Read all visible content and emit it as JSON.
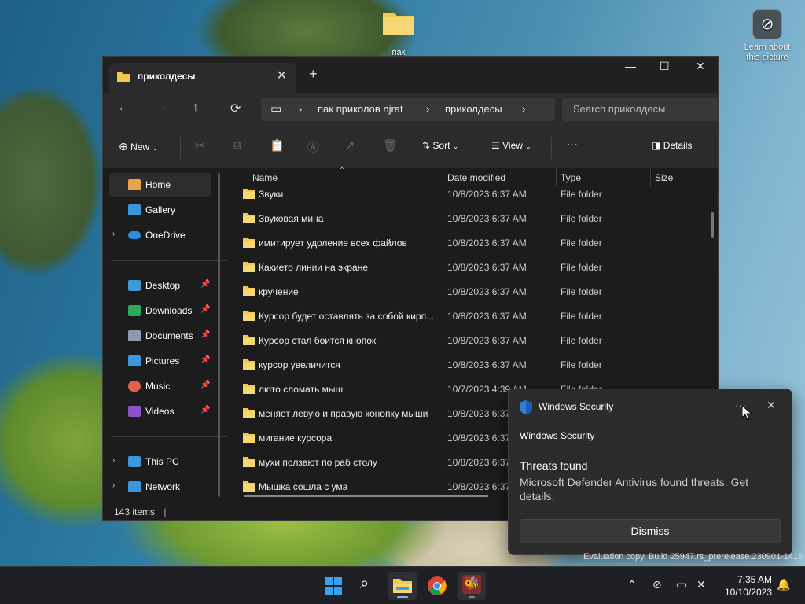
{
  "desktop": {
    "folder_label": "пак",
    "learn_label": "Learn about this picture"
  },
  "window": {
    "tab_title": "приколдесы",
    "new_tab": "+",
    "minimize": "—",
    "maximize": "☐",
    "close": "✕",
    "breadcrumb": [
      "пак приколов njrat",
      "приколдесы"
    ],
    "search_placeholder": "Search приколдесы"
  },
  "toolbar": {
    "new_label": "New",
    "sort_label": "Sort",
    "view_label": "View",
    "more": "···",
    "details_label": "Details"
  },
  "sidebar": {
    "items": [
      {
        "label": "Home",
        "icon": "home-icon",
        "color": "#e8a24b"
      },
      {
        "label": "Gallery",
        "icon": "gallery-icon",
        "color": "#3a96dd"
      },
      {
        "label": "OneDrive",
        "icon": "cloud-icon",
        "color": "#2b8de0"
      },
      {
        "label": "Desktop",
        "icon": "desktop-icon",
        "color": "#3a9bd5"
      },
      {
        "label": "Downloads",
        "icon": "download-icon",
        "color": "#2eaa5a"
      },
      {
        "label": "Documents",
        "icon": "document-icon",
        "color": "#8a9bb0"
      },
      {
        "label": "Pictures",
        "icon": "pictures-icon",
        "color": "#3a96dd"
      },
      {
        "label": "Music",
        "icon": "music-icon",
        "color": "#e0604b"
      },
      {
        "label": "Videos",
        "icon": "videos-icon",
        "color": "#8a54c8"
      },
      {
        "label": "This PC",
        "icon": "pc-icon",
        "color": "#3a96dd"
      },
      {
        "label": "Network",
        "icon": "network-icon",
        "color": "#3a96dd"
      }
    ]
  },
  "columns": {
    "name": "Name",
    "date": "Date modified",
    "type": "Type",
    "size": "Size"
  },
  "files": [
    {
      "name": "Звуки",
      "date": "10/8/2023 6:37 AM",
      "type": "File folder"
    },
    {
      "name": "Звуковая мина",
      "date": "10/8/2023 6:37 AM",
      "type": "File folder"
    },
    {
      "name": "имитирует удоление всех файлов",
      "date": "10/8/2023 6:37 AM",
      "type": "File folder"
    },
    {
      "name": "Какието линии на экране",
      "date": "10/8/2023 6:37 AM",
      "type": "File folder"
    },
    {
      "name": "кручение",
      "date": "10/8/2023 6:37 AM",
      "type": "File folder"
    },
    {
      "name": "Курсор будет оставлять за собой кирп...",
      "date": "10/8/2023 6:37 AM",
      "type": "File folder"
    },
    {
      "name": "Курсор стал боится кнопок",
      "date": "10/8/2023 6:37 AM",
      "type": "File folder"
    },
    {
      "name": "курсор увеличится",
      "date": "10/8/2023 6:37 AM",
      "type": "File folder"
    },
    {
      "name": "люто сломать мыш",
      "date": "10/7/2023 4:39 AM",
      "type": "File folder"
    },
    {
      "name": "меняет левую и правую конопку мыши",
      "date": "10/8/2023 6:37 AM",
      "type": ""
    },
    {
      "name": "мигание курсора",
      "date": "10/8/2023 6:37",
      "type": ""
    },
    {
      "name": "мухи ползают по раб столу",
      "date": "10/8/2023 6:37",
      "type": ""
    },
    {
      "name": "Мышка сошла с ума",
      "date": "10/8/2023 6:37",
      "type": ""
    }
  ],
  "status": {
    "count": "143 items"
  },
  "toast": {
    "app_name": "Windows Security",
    "more": "···",
    "close": "✕",
    "subtitle": "Windows Security",
    "heading": "Threats found",
    "message": "Microsoft Defender Antivirus found threats. Get details.",
    "button": "Dismiss"
  },
  "watermark": "Evaluation copy. Build 25947.rs_prerelease.230901-1416",
  "taskbar": {
    "apps": [
      "start-icon",
      "search-icon",
      "file-explorer-icon",
      "chrome-icon",
      "bee-app-icon"
    ],
    "time": "7:35 AM",
    "date": "10/10/2023"
  }
}
